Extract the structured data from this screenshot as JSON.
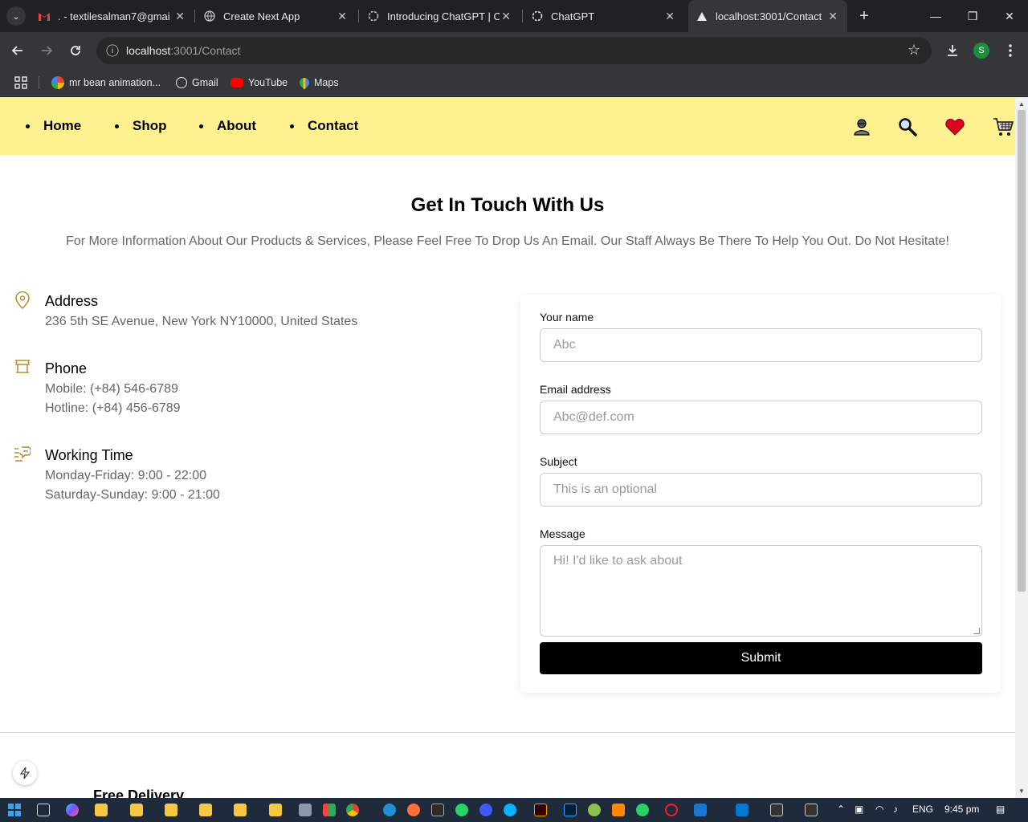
{
  "browser": {
    "tabs": [
      {
        "title": ". - textilesalman7@gmail.",
        "favicon": "gmail-icon"
      },
      {
        "title": "Create Next App",
        "favicon": "globe-icon"
      },
      {
        "title": "Introducing ChatGPT | Op",
        "favicon": "openai-icon"
      },
      {
        "title": "ChatGPT",
        "favicon": "openai-icon"
      },
      {
        "title": "localhost:3001/Contact",
        "favicon": "vercel-icon"
      }
    ],
    "url_host": "localhost",
    "url_path": ":3001/Contact",
    "profile_initial": "S",
    "bookmarks": [
      {
        "label": "mr bean animation...",
        "icon": "google-icon"
      },
      {
        "label": "Gmail",
        "icon": "globe-icon"
      },
      {
        "label": "YouTube",
        "icon": "youtube-icon"
      },
      {
        "label": "Maps",
        "icon": "maps-icon"
      }
    ]
  },
  "site": {
    "nav": [
      "Home",
      "Shop",
      "About",
      "Contact"
    ],
    "header_bg": "#fff190",
    "header_icons": [
      "user-icon",
      "search-icon",
      "heart-icon",
      "cart-icon"
    ]
  },
  "contact": {
    "heading": "Get In Touch With Us",
    "subtext": "For More Information About Our Products & Services, Please Feel Free To Drop Us An Email. Our Staff Always Be There To Help You Out. Do Not Hesitate!",
    "accent": "#b88e2f",
    "address": {
      "title": "Address",
      "lines": [
        "236 5th SE Avenue, New York NY10000, United States"
      ]
    },
    "phone": {
      "title": "Phone",
      "lines": [
        "Mobile: (+84) 546-6789",
        "Hotline: (+84) 456-6789"
      ]
    },
    "hours": {
      "title": "Working Time",
      "lines": [
        "Monday-Friday: 9:00 - 22:00",
        "Saturday-Sunday: 9:00 - 21:00"
      ]
    }
  },
  "form": {
    "name_label": "Your name",
    "name_placeholder": "Abc",
    "email_label": "Email address",
    "email_placeholder": "Abc@def.com",
    "subject_label": "Subject",
    "subject_placeholder": "This is an optional",
    "message_label": "Message",
    "message_placeholder": "Hi! I'd like to ask about",
    "submit_label": "Submit"
  },
  "footer_peek": {
    "title": "Free Delivery"
  },
  "taskbar": {
    "lang": "ENG",
    "time": "9:45 pm"
  }
}
